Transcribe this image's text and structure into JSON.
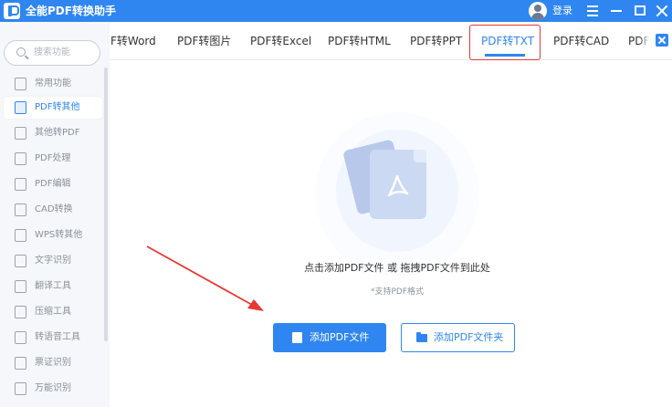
{
  "app": {
    "title": "全能PDF转换助手",
    "login_label": "登录",
    "icon": "app-logo-icon"
  },
  "sidebar": {
    "search_placeholder": "搜索功能",
    "items": [
      {
        "label": "常用功能",
        "icon": "star-grid-icon",
        "active": false
      },
      {
        "label": "PDF转其他",
        "icon": "pdf-convert-icon",
        "active": true
      },
      {
        "label": "其他转PDF",
        "icon": "to-pdf-icon",
        "active": false
      },
      {
        "label": "PDF处理",
        "icon": "pdf-process-icon",
        "active": false
      },
      {
        "label": "PDF编辑",
        "icon": "pdf-edit-icon",
        "active": false
      },
      {
        "label": "CAD转换",
        "icon": "cad-icon",
        "active": false
      },
      {
        "label": "WPS转其他",
        "icon": "wps-icon",
        "active": false
      },
      {
        "label": "文字识别",
        "icon": "ocr-icon",
        "active": false
      },
      {
        "label": "翻译工具",
        "icon": "translate-icon",
        "active": false
      },
      {
        "label": "压缩工具",
        "icon": "compress-icon",
        "active": false
      },
      {
        "label": "转语音工具",
        "icon": "speech-icon",
        "active": false
      },
      {
        "label": "票证识别",
        "icon": "ticket-icon",
        "active": false
      },
      {
        "label": "万能识别",
        "icon": "universal-scan-icon",
        "active": false
      }
    ]
  },
  "tabs": [
    {
      "label": "F转Word",
      "active": false
    },
    {
      "label": "PDF转图片",
      "active": false
    },
    {
      "label": "PDF转Excel",
      "active": false
    },
    {
      "label": "PDF转HTML",
      "active": false
    },
    {
      "label": "PDF转PPT",
      "active": false
    },
    {
      "label": "PDF转TXT",
      "active": true
    },
    {
      "label": "PDF转CAD",
      "active": false
    },
    {
      "label": "PDF",
      "active": false
    }
  ],
  "main": {
    "drop_hint": "点击添加PDF文件 或 拖拽PDF文件到此处",
    "format_hint": "*支持PDF格式",
    "add_file_label": "添加PDF文件",
    "add_folder_label": "添加PDF文件夹"
  },
  "colors": {
    "accent": "#2f86f0",
    "highlight": "#e53935",
    "sidebar_bg": "#f5f7fa"
  }
}
